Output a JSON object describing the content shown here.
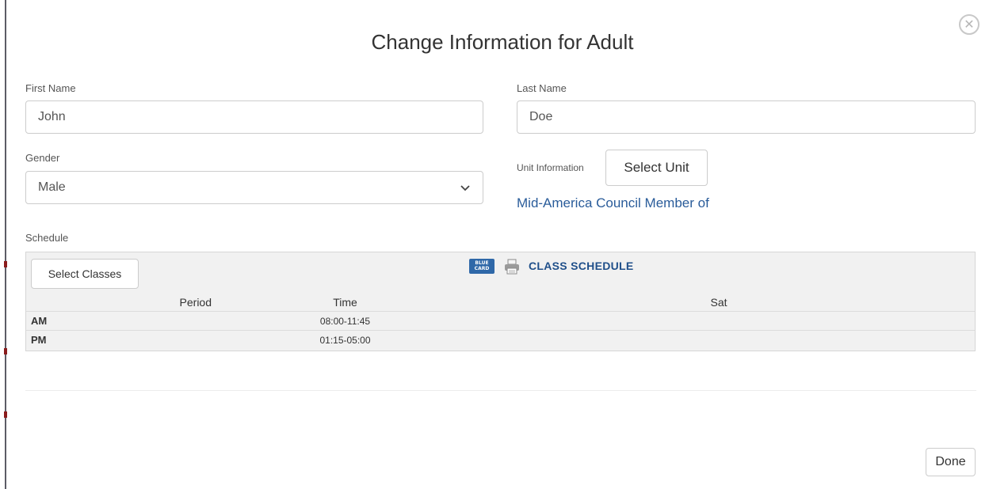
{
  "modal": {
    "title": "Change Information for Adult",
    "close_icon": "close-circle-icon"
  },
  "form": {
    "first_name": {
      "label": "First Name",
      "value": "John"
    },
    "last_name": {
      "label": "Last Name",
      "value": "Doe"
    },
    "gender": {
      "label": "Gender",
      "selected": "Male"
    },
    "unit": {
      "label": "Unit Information",
      "button_label": "Select Unit",
      "council_text": "Mid-America Council Member of"
    }
  },
  "schedule": {
    "label": "Schedule",
    "select_classes_label": "Select Classes",
    "blue_card_icon": "blue-card-icon",
    "blue_card_text": "BLUE CARD",
    "printer_icon": "printer-icon",
    "title": "CLASS SCHEDULE",
    "columns": [
      "Period",
      "Time",
      "Sat"
    ],
    "rows": [
      {
        "period": "AM",
        "time": "08:00-11:45",
        "sat": ""
      },
      {
        "period": "PM",
        "time": "01:15-05:00",
        "sat": ""
      }
    ]
  },
  "footer": {
    "done_label": "Done"
  },
  "colors": {
    "link": "#2a5c9a",
    "schedule_title": "#1f4f8a",
    "panel_bg": "#f1f1f1",
    "border": "#cccccc"
  }
}
